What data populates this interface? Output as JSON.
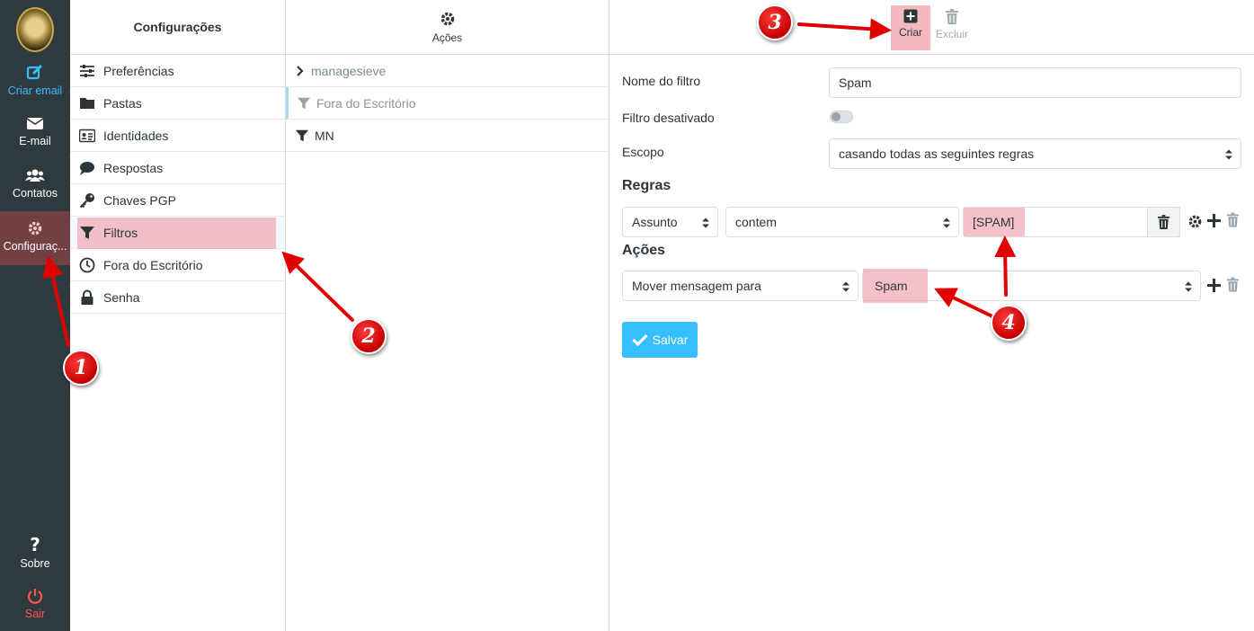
{
  "appbar": {
    "items": [
      {
        "label": "Criar email",
        "icon": "compose-icon"
      },
      {
        "label": "E-mail",
        "icon": "envelope-icon"
      },
      {
        "label": "Contatos",
        "icon": "users-icon"
      },
      {
        "label": "Configuraç...",
        "icon": "gear-icon"
      },
      {
        "label": "Sobre",
        "icon": "question-icon"
      },
      {
        "label": "Sair",
        "icon": "power-icon"
      }
    ]
  },
  "settings": {
    "title": "Configurações",
    "items": [
      {
        "label": "Preferências",
        "icon": "sliders-icon"
      },
      {
        "label": "Pastas",
        "icon": "folder-icon"
      },
      {
        "label": "Identidades",
        "icon": "id-card-icon"
      },
      {
        "label": "Respostas",
        "icon": "comment-icon"
      },
      {
        "label": "Chaves PGP",
        "icon": "key-icon"
      },
      {
        "label": "Filtros",
        "icon": "filter-icon"
      },
      {
        "label": "Fora do Escritório",
        "icon": "clock-icon"
      },
      {
        "label": "Senha",
        "icon": "lock-icon"
      }
    ]
  },
  "filters": {
    "actions_label": "Ações",
    "set_name": "managesieve",
    "items": [
      {
        "label": "Fora do Escritório"
      },
      {
        "label": "MN"
      }
    ]
  },
  "toolbar": {
    "create_label": "Criar",
    "delete_label": "Excluir"
  },
  "form": {
    "name_label": "Nome do filtro",
    "name_value": "Spam",
    "disabled_label": "Filtro desativado",
    "scope_label": "Escopo",
    "scope_value": "casando todas as seguintes regras",
    "rules_title": "Regras",
    "rule": {
      "header": "Assunto",
      "operator": "contem",
      "value": "[SPAM]"
    },
    "actions_title": "Ações",
    "action": {
      "type": "Mover mensagem para",
      "target": "Spam"
    },
    "save_label": "Salvar"
  },
  "annotations": [
    "1",
    "2",
    "3",
    "4"
  ],
  "colors": {
    "appbar_bg": "#2f3a3f",
    "accent": "#37beff",
    "highlight": "#f0a0aa",
    "arrow": "#e00000"
  }
}
